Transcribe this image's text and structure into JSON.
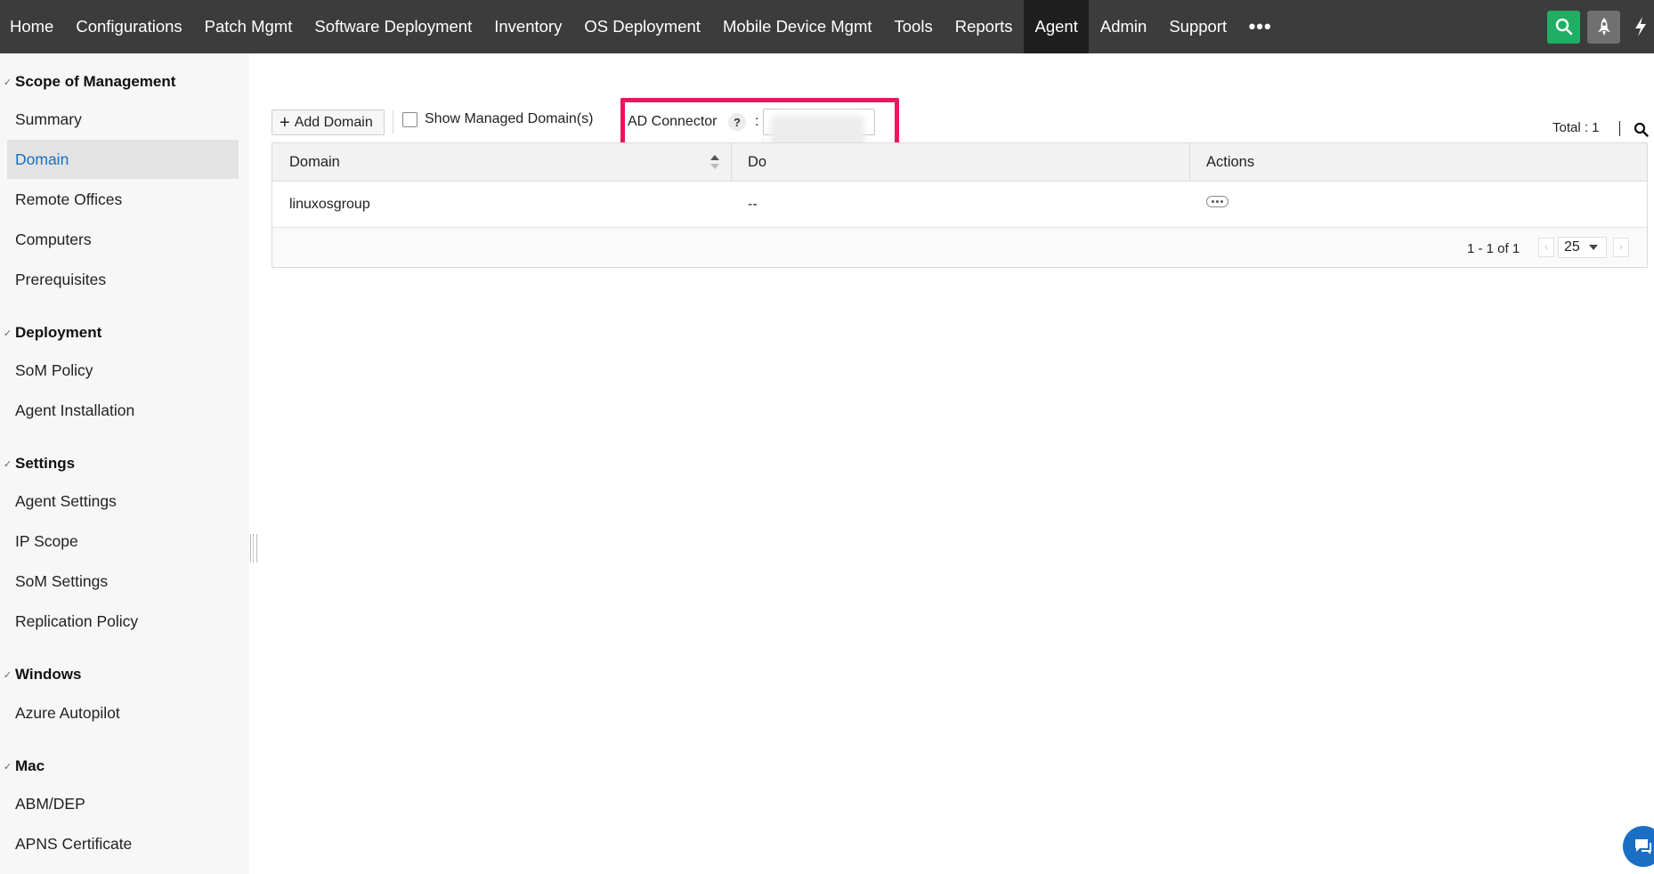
{
  "topnav": {
    "items": [
      {
        "label": "Home"
      },
      {
        "label": "Configurations"
      },
      {
        "label": "Patch Mgmt"
      },
      {
        "label": "Software Deployment"
      },
      {
        "label": "Inventory"
      },
      {
        "label": "OS Deployment"
      },
      {
        "label": "Mobile Device Mgmt"
      },
      {
        "label": "Tools"
      },
      {
        "label": "Reports"
      },
      {
        "label": "Agent",
        "active": true
      },
      {
        "label": "Admin"
      },
      {
        "label": "Support"
      }
    ],
    "more_label": "•••",
    "search_icon": "search-icon",
    "rocket_icon": "rocket-icon",
    "flash_icon": "lightning-icon",
    "accent_green": "#1fae63"
  },
  "sidebar": {
    "groups": [
      {
        "title": "Scope of Management",
        "items": [
          "Summary",
          "Domain",
          "Remote Offices",
          "Computers",
          "Prerequisites"
        ]
      },
      {
        "title": "Deployment",
        "items": [
          "SoM Policy",
          "Agent Installation"
        ]
      },
      {
        "title": "Settings",
        "items": [
          "Agent Settings",
          "IP Scope",
          "SoM Settings",
          "Replication Policy"
        ]
      },
      {
        "title": "Windows",
        "items": [
          "Azure Autopilot"
        ]
      },
      {
        "title": "Mac",
        "items": [
          "ABM/DEP",
          "APNS Certificate"
        ]
      }
    ],
    "active_item": "Domain",
    "active_color": "#1a6fc4"
  },
  "toolbar": {
    "add_domain_label": "Add Domain",
    "show_managed_label": "Show Managed Domain(s)",
    "show_managed_checked": false,
    "ad_connector_label": "AD Connector",
    "help_label": "?",
    "colon": ":",
    "total_label": "Total : 1",
    "highlight_color": "#e8175d"
  },
  "table": {
    "columns": [
      "Domain",
      "Do",
      "Actions"
    ],
    "rows": [
      {
        "domain": "linuxosgroup",
        "col2": "--"
      }
    ],
    "pagination": {
      "range_label": "1 - 1 of 1",
      "page_size": "25"
    }
  }
}
